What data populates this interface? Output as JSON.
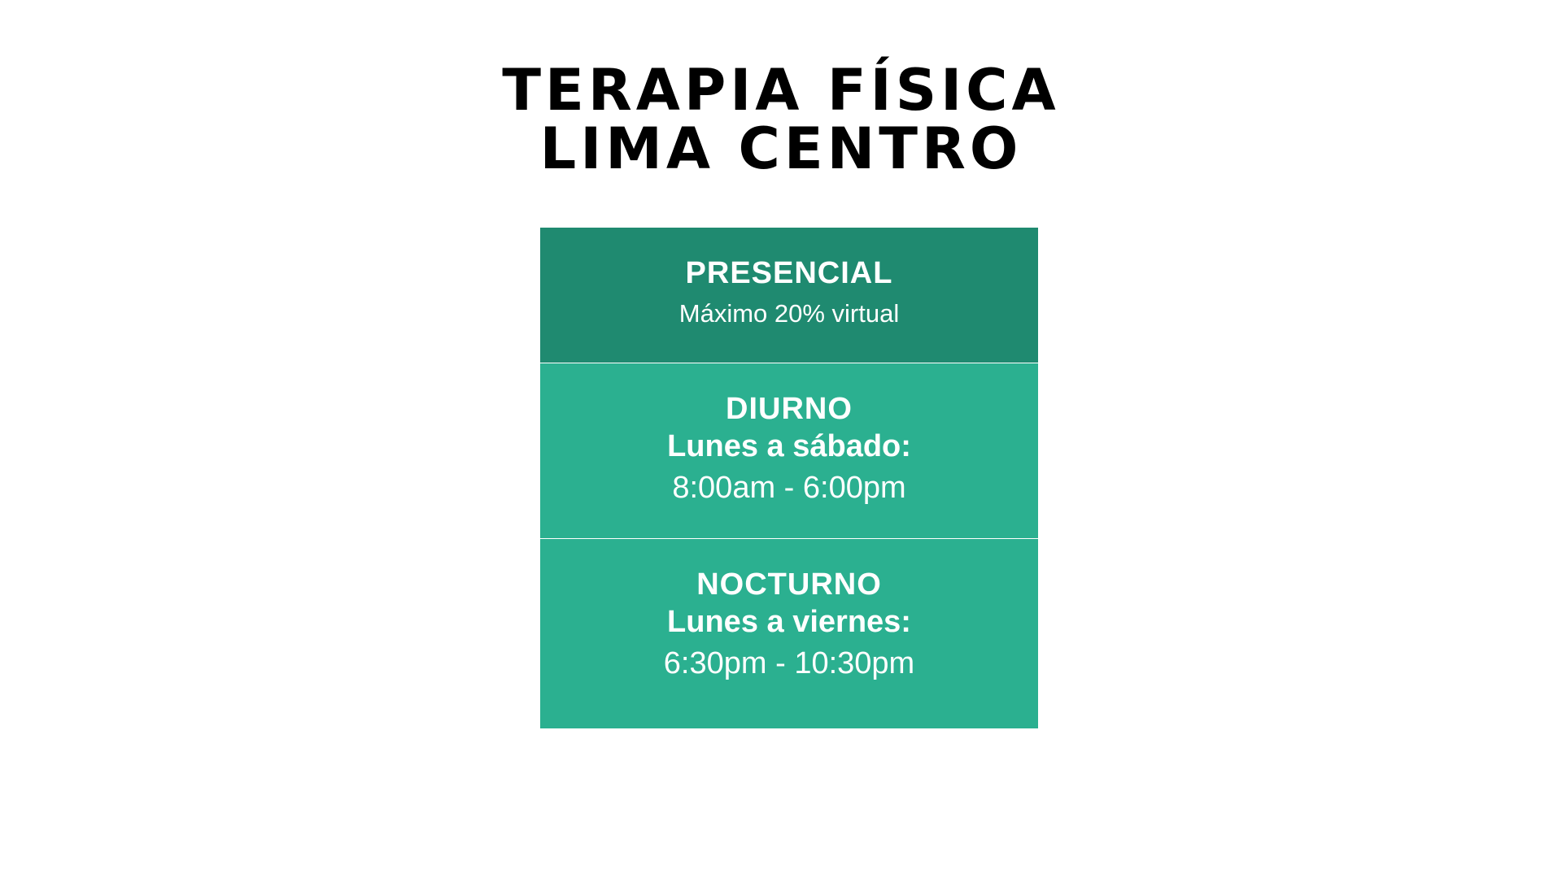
{
  "header": {
    "title_line1": "TERAPIA FÍSICA",
    "title_line2": "LIMA CENTRO"
  },
  "schedule": {
    "presencial": {
      "title": "PRESENCIAL",
      "note": "Máximo 20% virtual",
      "color": "#1f8a70"
    },
    "diurno": {
      "title": "DIURNO",
      "days": "Lunes a sábado:",
      "hours": "8:00am - 6:00pm",
      "color": "#2bb090"
    },
    "nocturno": {
      "title": "NOCTURNO",
      "days": "Lunes a viernes:",
      "hours": "6:30pm - 10:30pm",
      "color": "#2bb090"
    }
  }
}
